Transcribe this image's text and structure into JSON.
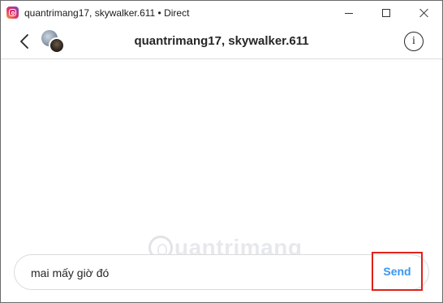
{
  "window": {
    "title": "quantrimang17, skywalker.611 • Direct",
    "app_icon": "instagram-icon"
  },
  "header": {
    "back_icon": "chevron-left-icon",
    "title": "quantrimang17, skywalker.611",
    "info_icon": "info-icon",
    "info_glyph": "i"
  },
  "watermark": {
    "text": "uantrimang"
  },
  "composer": {
    "value": "mai mấy giờ đó",
    "send_label": "Send"
  },
  "colors": {
    "send": "#3897f0",
    "highlight": "#e0201b",
    "border": "#dbdbdb"
  }
}
